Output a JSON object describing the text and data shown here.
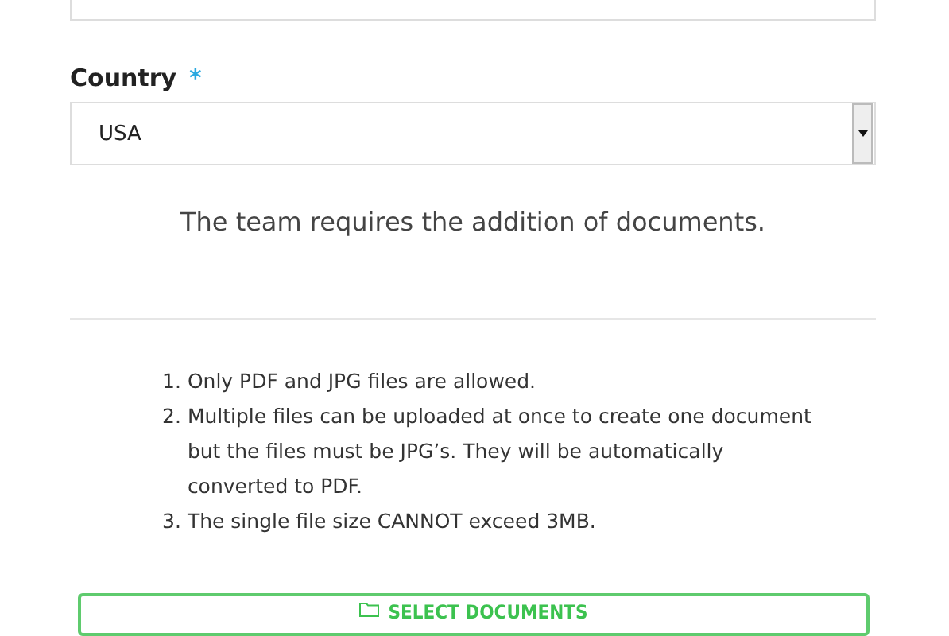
{
  "country_field": {
    "label": "Country",
    "required_mark": "*",
    "value": "USA"
  },
  "message": "The team requires the addition of documents.",
  "rules": [
    {
      "number": "1.",
      "text": "Only PDF and JPG files are allowed."
    },
    {
      "number": "2.",
      "text": "Multiple files can be uploaded at once to create one document but the files must be JPG’s. They will be automatically converted to PDF."
    },
    {
      "number": "3.",
      "text": "The single file size CANNOT exceed 3MB."
    }
  ],
  "select_button": {
    "label": "SELECT DOCUMENTS"
  }
}
